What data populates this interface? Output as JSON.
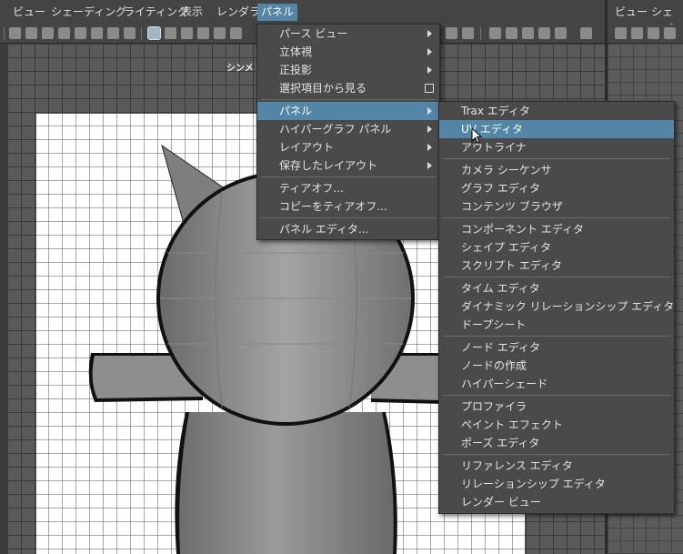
{
  "menubar": {
    "items": [
      "ビュー",
      "シェーディング",
      "ライティング",
      "表示",
      "レンダラ",
      "パネル"
    ],
    "right_items": [
      "ビュー",
      "シェーディ"
    ]
  },
  "viewport": {
    "camera_label": "シンメトリ"
  },
  "panel_menu": {
    "items": [
      {
        "label": "パース ビュー"
      },
      {
        "label": "立体視"
      },
      {
        "label": "正投影"
      },
      {
        "label": "選択項目から見る"
      },
      {
        "label": "パネル"
      },
      {
        "label": "ハイパーグラフ パネル"
      },
      {
        "label": "レイアウト"
      },
      {
        "label": "保存したレイアウト"
      },
      {
        "label": "ティアオフ..."
      },
      {
        "label": "コピーをティアオフ..."
      },
      {
        "label": "パネル エディタ..."
      }
    ]
  },
  "panel_submenu": {
    "items": [
      {
        "label": "Trax エディタ"
      },
      {
        "label": "UV エディタ"
      },
      {
        "label": "アウトライナ"
      },
      {
        "label": "カメラ シーケンサ"
      },
      {
        "label": "グラフ エディタ"
      },
      {
        "label": "コンテンツ ブラウザ"
      },
      {
        "label": "コンポーネント エディタ"
      },
      {
        "label": "シェイプ エディタ"
      },
      {
        "label": "スクリプト エディタ"
      },
      {
        "label": "タイム エディタ"
      },
      {
        "label": "ダイナミック リレーションシップ エディタ"
      },
      {
        "label": "ドープシート"
      },
      {
        "label": "ノード エディタ"
      },
      {
        "label": "ノードの作成"
      },
      {
        "label": "ハイパーシェード"
      },
      {
        "label": "プロファイラ"
      },
      {
        "label": "ペイント エフェクト"
      },
      {
        "label": "ポーズ エディタ"
      },
      {
        "label": "リファレンス エディタ"
      },
      {
        "label": "リレーションシップ エディタ"
      },
      {
        "label": "レンダー ビュー"
      }
    ]
  },
  "colors": {
    "highlight": "#5285a6",
    "menu_bg": "#4a4a4a",
    "viewport_bg": "#5a5a5a"
  }
}
